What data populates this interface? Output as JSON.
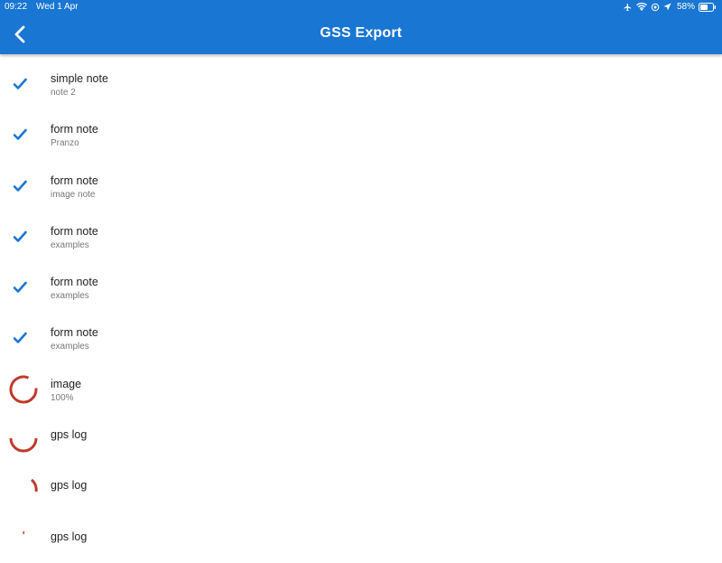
{
  "status_bar": {
    "time": "09:22",
    "date": "Wed 1 Apr",
    "battery": "58%",
    "icons": [
      "airplane-icon",
      "wifi-icon",
      "location-lock-icon",
      "location-arrow-icon",
      "battery-icon"
    ]
  },
  "header": {
    "title": "GSS Export",
    "back_icon": "chevron-left-icon",
    "color": "#1976d2"
  },
  "colors": {
    "check": "#1976d2",
    "progress": "#c0392b"
  },
  "items": [
    {
      "title": "simple note",
      "subtitle": "note 2",
      "status": "done",
      "icon": "check-icon"
    },
    {
      "title": "form note",
      "subtitle": "Pranzo",
      "status": "done",
      "icon": "check-icon"
    },
    {
      "title": "form note",
      "subtitle": "image note",
      "status": "done",
      "icon": "check-icon"
    },
    {
      "title": "form note",
      "subtitle": "examples",
      "status": "done",
      "icon": "check-icon"
    },
    {
      "title": "form note",
      "subtitle": "examples",
      "status": "done",
      "icon": "check-icon"
    },
    {
      "title": "form note",
      "subtitle": "examples",
      "status": "done",
      "icon": "check-icon"
    },
    {
      "title": "image",
      "subtitle": "100%",
      "status": "uploading",
      "icon": "progress-spinner-icon"
    },
    {
      "title": "gps log",
      "subtitle": "",
      "status": "uploading",
      "icon": "progress-spinner-icon"
    },
    {
      "title": "gps log",
      "subtitle": "",
      "status": "uploading",
      "icon": "progress-spinner-icon"
    },
    {
      "title": "gps log",
      "subtitle": "",
      "status": "uploading",
      "icon": "progress-spinner-icon"
    }
  ]
}
